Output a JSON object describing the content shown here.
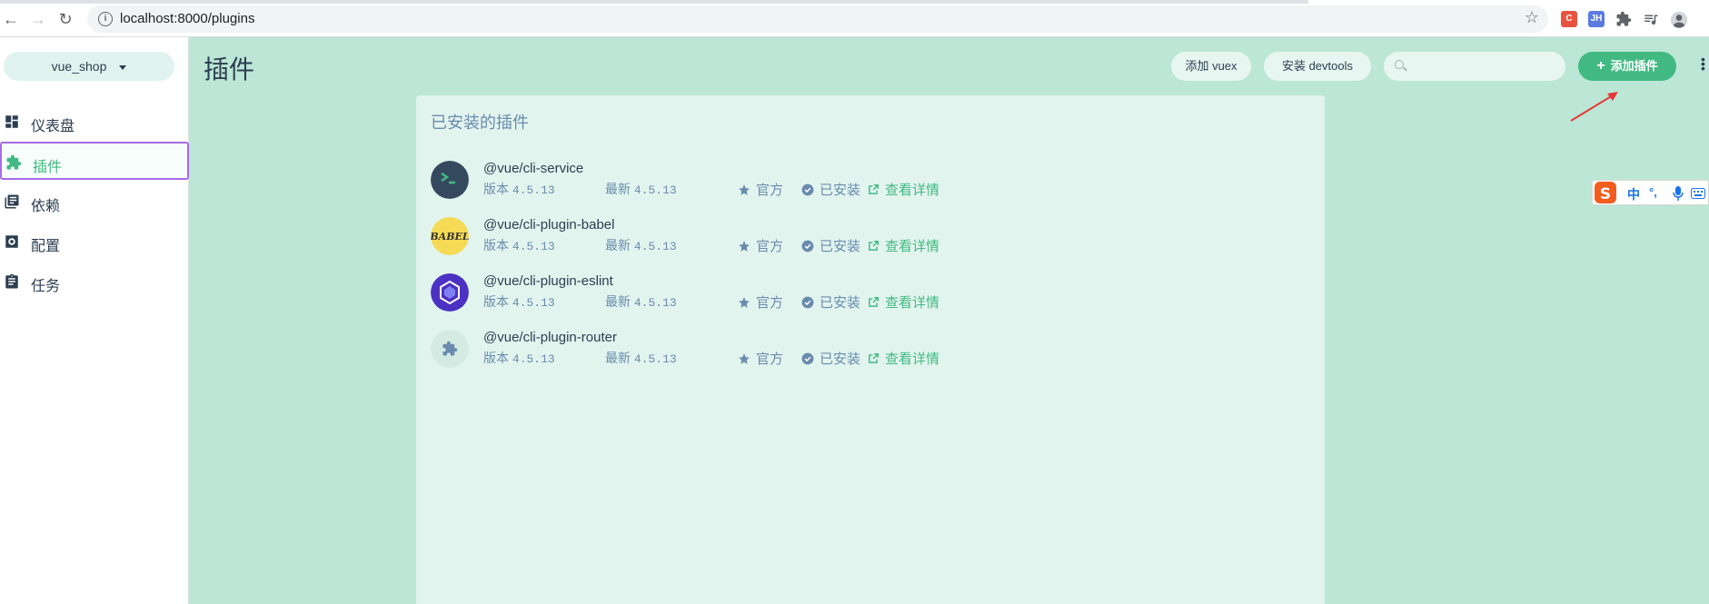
{
  "browser": {
    "url": "localhost:8000/plugins",
    "ext_c": "C",
    "ext_jh": "JH"
  },
  "sidebar": {
    "project": "vue_shop",
    "items": [
      {
        "label": "仪表盘",
        "icon": "dashboard-icon"
      },
      {
        "label": "插件",
        "icon": "puzzle-icon",
        "active": true
      },
      {
        "label": "依赖",
        "icon": "library-icon"
      },
      {
        "label": "配置",
        "icon": "settings-icon"
      },
      {
        "label": "任务",
        "icon": "clipboard-icon"
      }
    ]
  },
  "header": {
    "title": "插件",
    "add_vuex": "添加 vuex",
    "install_devtools": "安装 devtools",
    "search_placeholder": "",
    "add_plugin": "添加插件"
  },
  "panel": {
    "title": "已安装的插件",
    "version_label": "版本",
    "latest_label": "最新",
    "official_label": "官方",
    "installed_label": "已安装",
    "details_label": "查看详情",
    "plugins": [
      {
        "name": "@vue/cli-service",
        "version": "4.5.13",
        "latest": "4.5.13",
        "logo": "cli-service-logo"
      },
      {
        "name": "@vue/cli-plugin-babel",
        "version": "4.5.13",
        "latest": "4.5.13",
        "logo": "babel-logo"
      },
      {
        "name": "@vue/cli-plugin-eslint",
        "version": "4.5.13",
        "latest": "4.5.13",
        "logo": "eslint-logo"
      },
      {
        "name": "@vue/cli-plugin-router",
        "version": "4.5.13",
        "latest": "4.5.13",
        "logo": "puzzle-logo"
      }
    ]
  },
  "ime": {
    "lang": "中",
    "punct": "°,"
  },
  "colors": {
    "accent": "#42b983",
    "background": "#bce6d6",
    "panel": "#e2f4ee"
  }
}
